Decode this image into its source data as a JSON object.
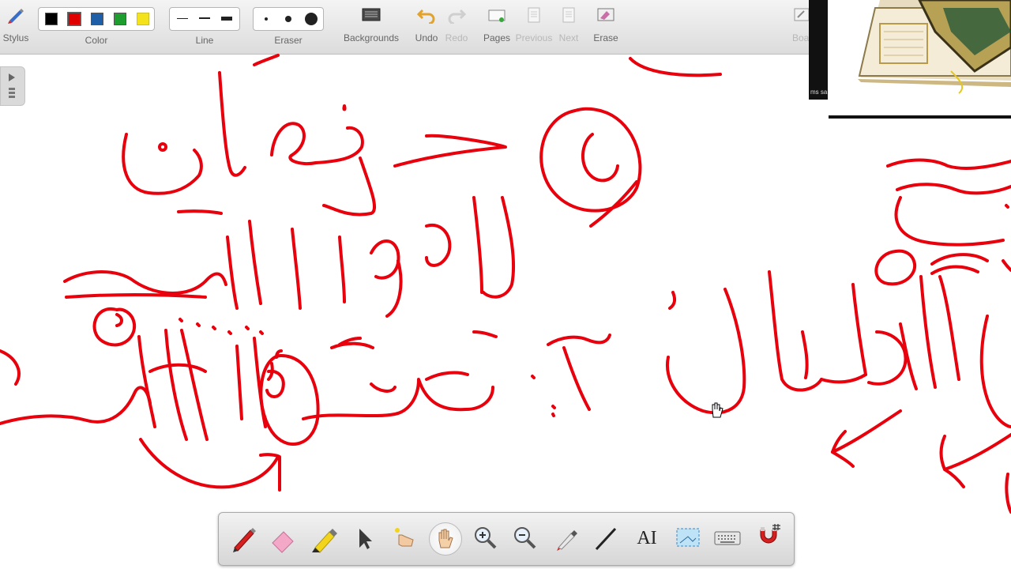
{
  "toolbar": {
    "stylus_label": "Stylus",
    "color_label": "Color",
    "line_label": "Line",
    "eraser_label": "Eraser",
    "backgrounds_label": "Backgrounds",
    "undo_label": "Undo",
    "redo_label": "Redo",
    "pages_label": "Pages",
    "previous_label": "Previous",
    "next_label": "Next",
    "erase_label": "Erase",
    "board_label": "Boa",
    "colors": [
      "#000000",
      "#e00000",
      "#1f5fa8",
      "#1e9e2e",
      "#f3e21c"
    ]
  },
  "video": {
    "participant_label": "ms sa"
  },
  "ink_color": "#e8000c",
  "palette": {
    "tools": [
      "pen-tool-icon",
      "eraser-tool-icon",
      "highlighter-tool-icon",
      "select-arrow-icon",
      "laser-pointer-icon",
      "hand-pan-icon",
      "zoom-in-icon",
      "zoom-out-icon",
      "eyedropper-icon",
      "line-tool-icon",
      "text-tool-icon",
      "screen-capture-icon",
      "keyboard-icon",
      "magnet-icon"
    ],
    "active_tool": "hand-pan-icon",
    "text_tool_glyph": "AI"
  }
}
